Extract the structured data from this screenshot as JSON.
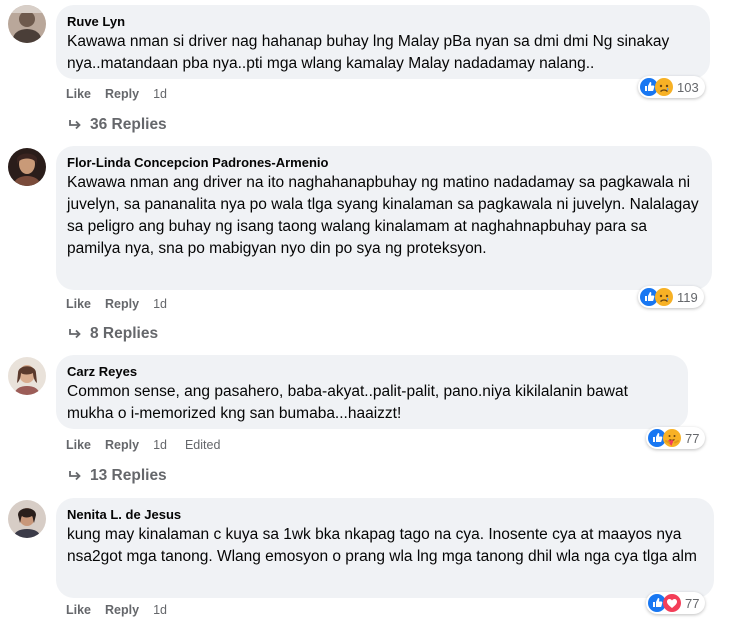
{
  "comments": [
    {
      "author": "Ruve Lyn",
      "text": "Kawawa nman si driver nag hahanap buhay lng Malay pBa nyan sa dmi dmi Ng sinakay nya..matandaan pba nya..pti mga wlang kamalay Malay nadadamay nalang..",
      "like": "Like",
      "reply": "Reply",
      "time": "1d",
      "reactions": [
        "like",
        "sad"
      ],
      "reaction_count": "103",
      "replies": "36 Replies"
    },
    {
      "author": "Flor-Linda Concepcion Padrones-Armenio",
      "text": "Kawawa nman ang driver na ito naghahanapbuhay ng matino nadadamay sa pagkawala ni juvelyn, sa pananalita nya po wala tlga syang kinalaman sa pagkawala ni juvelyn. Nalalagay sa peligro ang buhay ng isang taong walang kinalamam at naghahnapbuhay para sa pamilya nya, sna po mabigyan nyo din po sya ng proteksyon.",
      "like": "Like",
      "reply": "Reply",
      "time": "1d",
      "reactions": [
        "like",
        "sad"
      ],
      "reaction_count": "119",
      "replies": "8 Replies"
    },
    {
      "author": "Carz Reyes",
      "text": "Common sense, ang pasahero, baba-akyat..palit-palit, pano.niya kikilalanin bawat mukha o i-memorized kng san bumaba...haaizzt!",
      "like": "Like",
      "reply": "Reply",
      "time": "1d",
      "edited": "Edited",
      "reactions": [
        "like",
        "care"
      ],
      "reaction_count": "77",
      "replies": "13 Replies"
    },
    {
      "author": "Nenita L. de Jesus",
      "text": "kung may kinalaman c kuya sa 1wk bka nkapag tago na cya. Inosente cya at maayos nya nsa2got mga tanong. Wlang emosyon o prang wla lng mga tanong dhil wla nga cya tlga alm",
      "like": "Like",
      "reply": "Reply",
      "time": "1d",
      "reactions": [
        "like",
        "love"
      ],
      "reaction_count": "77"
    }
  ],
  "colors": {
    "bubble": "#f0f2f5",
    "meta": "#65676b",
    "like_blue": "#1877f2",
    "sad_yellow": "#f7b125",
    "love_red": "#f33e58"
  }
}
